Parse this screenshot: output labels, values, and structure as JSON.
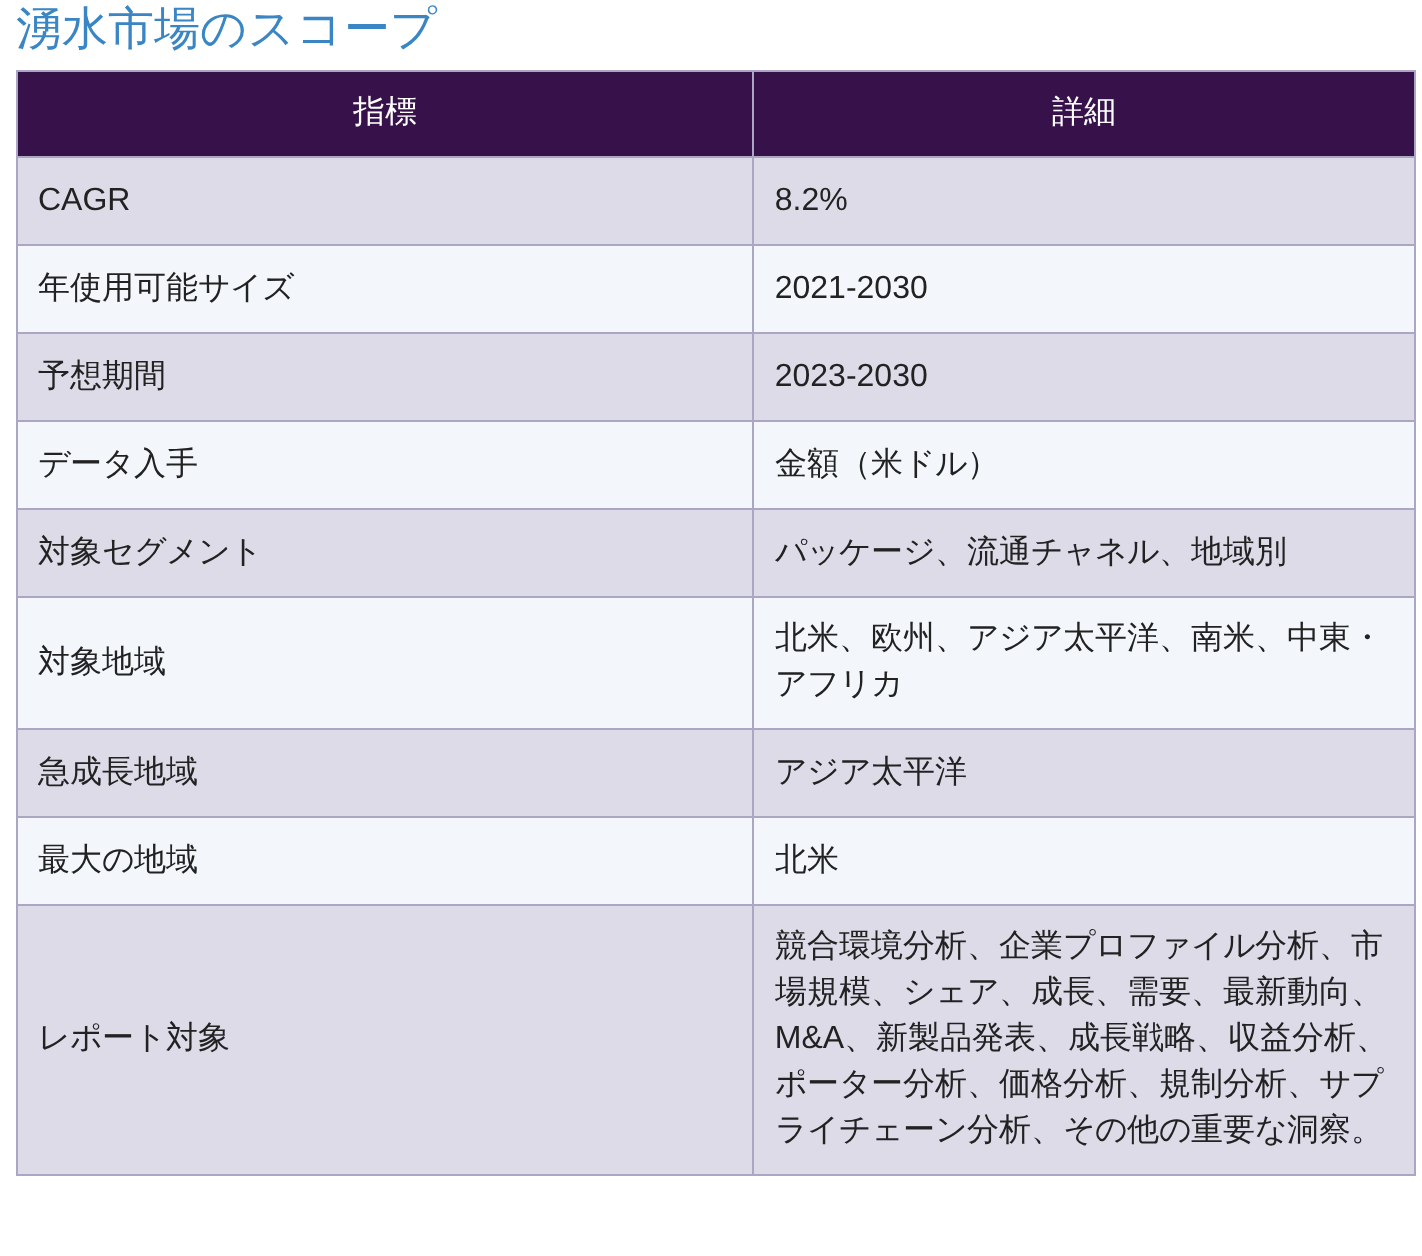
{
  "title": "湧水市場のスコープ",
  "table": {
    "columns": [
      "指標",
      "詳細"
    ],
    "rows": [
      [
        "CAGR",
        "8.2%"
      ],
      [
        "年使用可能サイズ",
        "2021-2030"
      ],
      [
        "予想期間",
        "2023-2030"
      ],
      [
        "データ入手",
        "金額（米ドル）"
      ],
      [
        "対象セグメント",
        "パッケージ、流通チャネル、地域別"
      ],
      [
        "対象地域",
        "北米、欧州、アジア太平洋、南米、中東・アフリカ"
      ],
      [
        "急成長地域",
        "アジア太平洋"
      ],
      [
        "最大の地域",
        "北米"
      ],
      [
        "レポート対象",
        "競合環境分析、企業プロファイル分析、市場規模、シェア、成長、需要、最新動向、M&A、新製品発表、成長戦略、収益分析、ポーター分析、価格分析、規制分析、サプライチェーン分析、その他の重要な洞察。"
      ]
    ]
  }
}
